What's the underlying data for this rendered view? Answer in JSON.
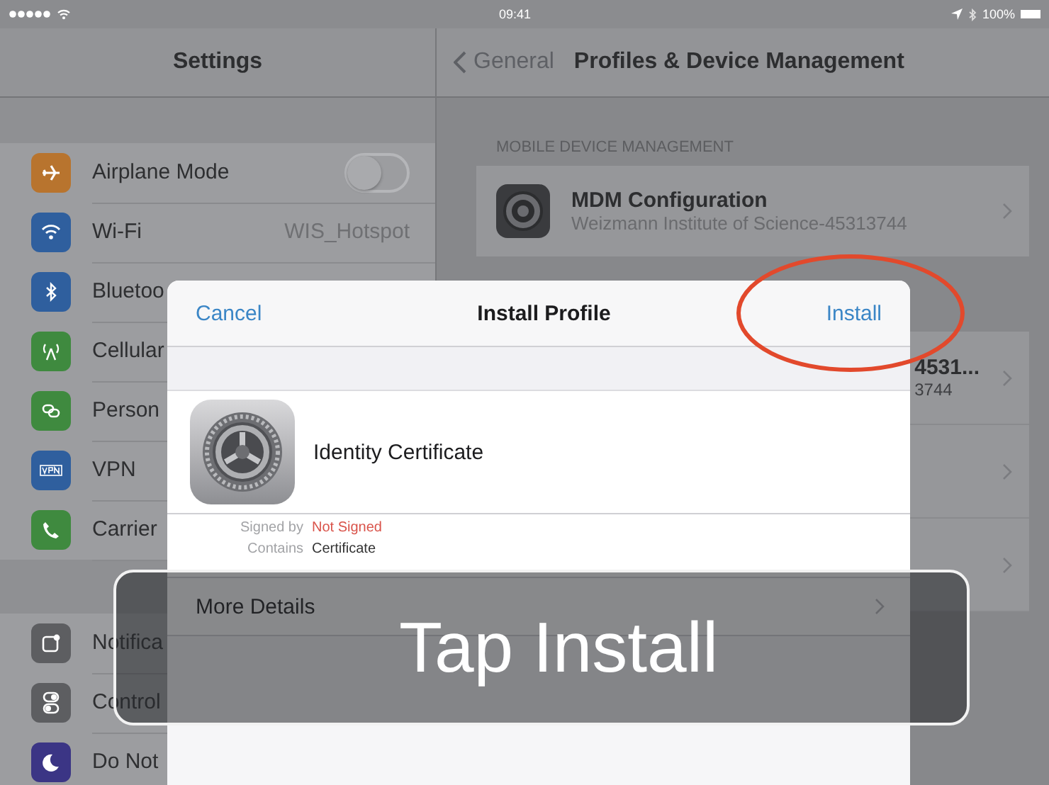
{
  "status_bar": {
    "time": "09:41",
    "battery": "100%"
  },
  "sidebar": {
    "title": "Settings",
    "groups": [
      [
        {
          "label": "Airplane Mode",
          "kind": "toggle",
          "on": false,
          "color": "#b8742e"
        },
        {
          "label": "Wi-Fi",
          "kind": "value",
          "value": "WIS_Hotspot",
          "color": "#2f5f9e"
        },
        {
          "label": "Bluetoo",
          "kind": "plain",
          "color": "#2f5f9e"
        },
        {
          "label": "Cellular",
          "kind": "plain",
          "color": "#3f8a3f"
        },
        {
          "label": "Person",
          "kind": "plain",
          "color": "#3f8a3f"
        },
        {
          "label": "VPN",
          "kind": "plain",
          "color": "#2f5f9e"
        },
        {
          "label": "Carrier",
          "kind": "plain",
          "color": "#3f8a3f"
        }
      ],
      [
        {
          "label": "Notifica",
          "kind": "plain",
          "color": "#5d5e61"
        },
        {
          "label": "Control",
          "kind": "plain",
          "color": "#5d5e61"
        },
        {
          "label": "Do Not",
          "kind": "plain",
          "color": "#3b3585"
        }
      ]
    ]
  },
  "detail": {
    "back": "General",
    "title": "Profiles & Device Management",
    "section": "MOBILE DEVICE MANAGEMENT",
    "mdm": {
      "title": "MDM Configuration",
      "subtitle": "Weizmann Institute of Science-45313744"
    },
    "other": {
      "title": "4531...",
      "subtitle": "3744"
    }
  },
  "dialog": {
    "cancel": "Cancel",
    "title": "Install Profile",
    "install": "Install",
    "profile": "Identity Certificate",
    "details": [
      {
        "label": "Signed by",
        "value": "Not Signed",
        "kind": "warning"
      },
      {
        "label": "Contains",
        "value": "Certificate",
        "kind": "normal"
      }
    ],
    "more": "More Details"
  },
  "caption": "Tap Install"
}
